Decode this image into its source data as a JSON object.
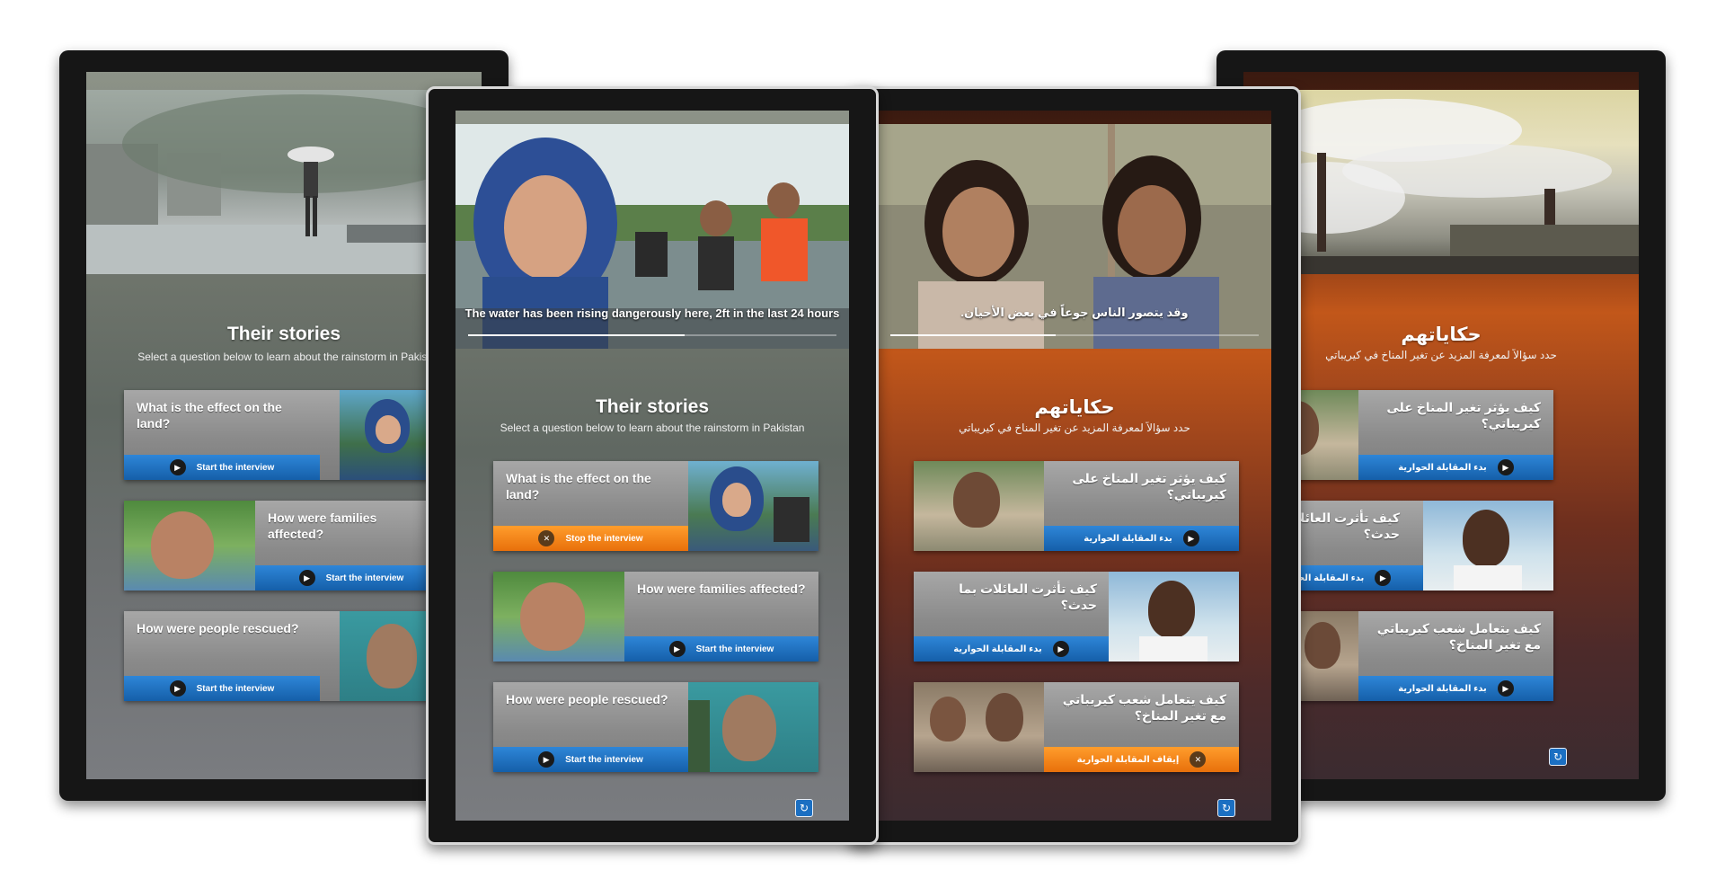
{
  "en": {
    "caption": "The water has been rising dangerously here, 2ft in the last 24 hours",
    "title": "Their stories",
    "subtitle_full": "Select a question below to learn about the rainstorm in Pakistan",
    "subtitle_cut": "Select a question below to learn about the rainstorm in Pakist",
    "q1": "What is the effect on the land?",
    "q2": "How were families affected?",
    "q3": "How were people rescued?",
    "start": "Start the interview",
    "stop": "Stop the interview"
  },
  "ar": {
    "caption": "وقد يتصور الناس جوعاً في بعض الأحيان.",
    "title": "حكاياتهم",
    "subtitle": "حدد سؤالاً لمعرفة المزيد عن تغير المناخ في كيريباتي",
    "q1": "كيف يؤثر تغير المناخ على كيريباتي؟",
    "q2": "كيف تأثرت العائلات بما حدث؟",
    "q3": "كيف يتعامل شعب كيريباتي مع تغير المناخ؟",
    "start": "بدء المقابلة الحوارية",
    "stop": "إيقاف المقابلة الحوارية"
  },
  "icons": {
    "play": "play-icon",
    "stop": "close-icon",
    "reload": "reload-icon"
  },
  "colors": {
    "button_blue": "#1b6fc2",
    "button_orange": "#f0851a"
  }
}
